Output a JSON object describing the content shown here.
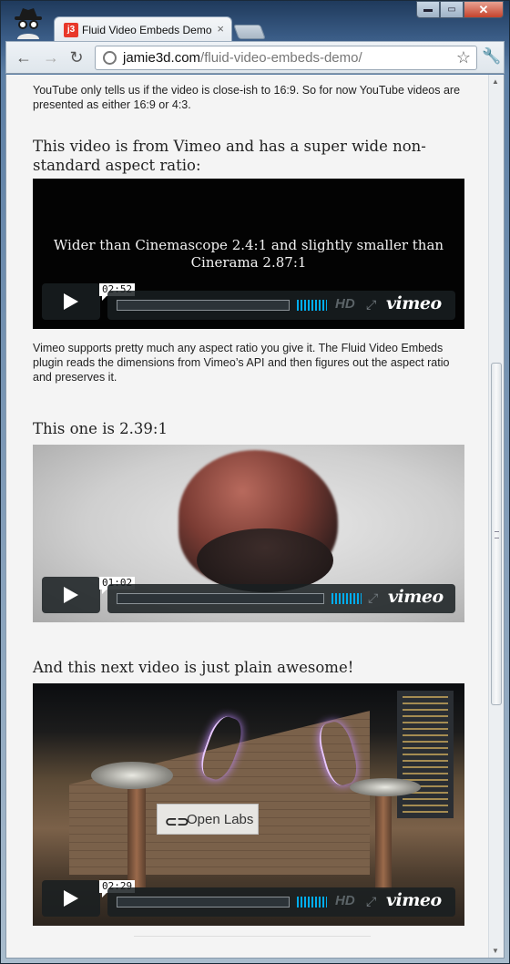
{
  "browser": {
    "tab_title": "Fluid Video Embeds Demo",
    "tab_favicon": "j3",
    "tab_close": "×",
    "url_host": "jamie3d.com",
    "url_path": "/fluid-video-embeds-demo/",
    "window_min": "▬",
    "window_max": "▭",
    "window_close": "✕"
  },
  "content": {
    "intro_text": "YouTube only tells us if the video is close-ish to 16:9. So for now YouTube videos are presented as either 16:9 or 4:3.",
    "heading1": "This video is from Vimeo and has a super wide non-standard aspect ratio:",
    "video1": {
      "caption": "Wider than Cinemascope 2.4:1 and slightly smaller than Cinerama 2.87:1",
      "timecode": "02:52",
      "hd": "HD",
      "brand": "vimeo"
    },
    "paragraph2": "Vimeo supports pretty much any aspect ratio you give it. The Fluid Video Embeds plugin reads the dimensions from Vimeo’s API and then figures out the aspect ratio and preserves it.",
    "heading2": "This one is 2.39:1",
    "video2": {
      "timecode": "01:02",
      "brand": "vimeo"
    },
    "heading3": "And this next video is just plain awesome!",
    "video3": {
      "timecode": "02:29",
      "hd": "HD",
      "brand": "vimeo",
      "sign_text": "Open Labs"
    }
  }
}
